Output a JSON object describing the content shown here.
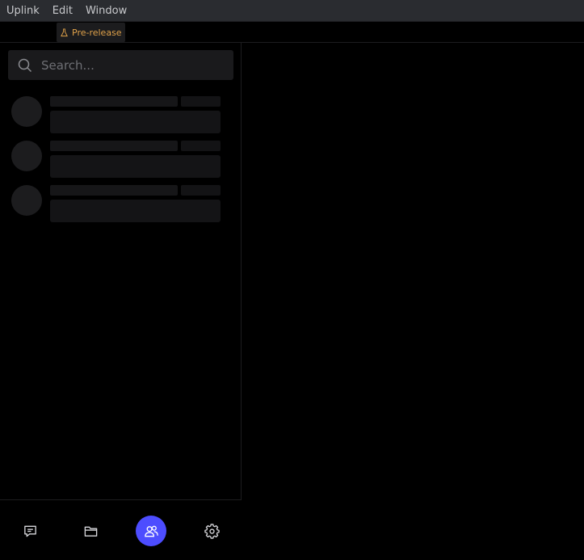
{
  "menubar": {
    "items": [
      {
        "label": "Uplink"
      },
      {
        "label": "Edit"
      },
      {
        "label": "Window"
      }
    ]
  },
  "badge": {
    "label": "Pre-release",
    "icon": "flask-icon",
    "color": "#e0a24a"
  },
  "search": {
    "placeholder": "Search...",
    "value": "",
    "icon": "search-icon"
  },
  "navbar": {
    "items": [
      {
        "icon": "chat-icon",
        "active": false
      },
      {
        "icon": "folder-icon",
        "active": false
      },
      {
        "icon": "friends-icon",
        "active": true
      },
      {
        "icon": "gear-icon",
        "active": false
      }
    ],
    "accent": "#4d4dff"
  }
}
